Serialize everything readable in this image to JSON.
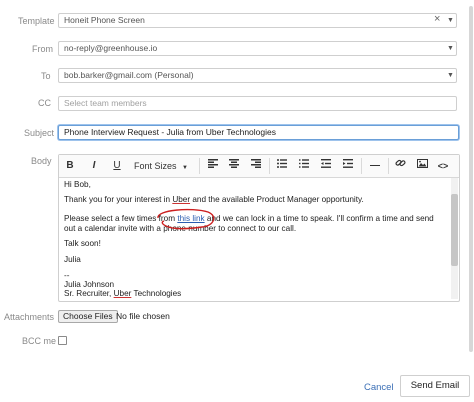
{
  "form": {
    "template": {
      "label": "Template",
      "value": "Honeit Phone Screen",
      "clear_glyph": "×",
      "arrow_glyph": "▼"
    },
    "from": {
      "label": "From",
      "value": "no-reply@greenhouse.io",
      "arrow_glyph": "▼"
    },
    "to": {
      "label": "To",
      "value": "bob.barker@gmail.com (Personal)",
      "arrow_glyph": "▼"
    },
    "cc": {
      "label": "CC",
      "placeholder": "Select team members"
    },
    "subject": {
      "label": "Subject",
      "value": "Phone Interview Request - Julia from Uber Technologies"
    },
    "body": {
      "label": "Body"
    },
    "attachments": {
      "label": "Attachments",
      "button": "Choose Files",
      "status": "No file chosen"
    },
    "bcc": {
      "label": "BCC me",
      "checked": false
    }
  },
  "toolbar": {
    "bold": "B",
    "italic": "I",
    "underline": "U",
    "font_sizes": "Font Sizes",
    "font_sizes_arrow": "▼",
    "hr": "—",
    "code": "<>"
  },
  "email": {
    "greeting": "Hi Bob,",
    "p1_a": "Thank you for your interest in ",
    "p1_uber": "Uber",
    "p1_b": " and the available Product Manager opportunity.",
    "p2_a": "Please select a few times from ",
    "p2_link": "this link",
    "p2_b": " and we can lock in a time to speak. I'll confirm a time and send out a calendar invite with a phone number to connect to our call.",
    "closing": "Talk soon!",
    "name": "Julia",
    "sig_dash": "--",
    "sig_name": "Julia Johnson",
    "sig_title_a": "Sr. Recruiter, ",
    "sig_uber": "Uber",
    "sig_title_b": " Technologies"
  },
  "actions": {
    "cancel": "Cancel",
    "send": "Send Email"
  },
  "colors": {
    "annotation_circle": "#cc2020",
    "link": "#2a5db0",
    "focus_border": "#6a9fd8"
  }
}
